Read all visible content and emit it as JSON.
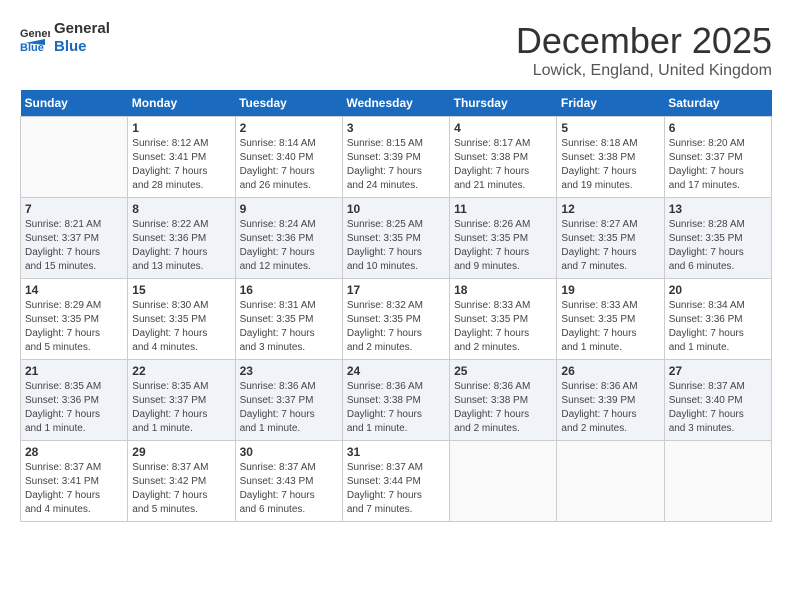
{
  "logo": {
    "general": "General",
    "blue": "Blue"
  },
  "title": "December 2025",
  "subtitle": "Lowick, England, United Kingdom",
  "days_header": [
    "Sunday",
    "Monday",
    "Tuesday",
    "Wednesday",
    "Thursday",
    "Friday",
    "Saturday"
  ],
  "weeks": [
    [
      {
        "day": "",
        "content": ""
      },
      {
        "day": "1",
        "content": "Sunrise: 8:12 AM\nSunset: 3:41 PM\nDaylight: 7 hours\nand 28 minutes."
      },
      {
        "day": "2",
        "content": "Sunrise: 8:14 AM\nSunset: 3:40 PM\nDaylight: 7 hours\nand 26 minutes."
      },
      {
        "day": "3",
        "content": "Sunrise: 8:15 AM\nSunset: 3:39 PM\nDaylight: 7 hours\nand 24 minutes."
      },
      {
        "day": "4",
        "content": "Sunrise: 8:17 AM\nSunset: 3:38 PM\nDaylight: 7 hours\nand 21 minutes."
      },
      {
        "day": "5",
        "content": "Sunrise: 8:18 AM\nSunset: 3:38 PM\nDaylight: 7 hours\nand 19 minutes."
      },
      {
        "day": "6",
        "content": "Sunrise: 8:20 AM\nSunset: 3:37 PM\nDaylight: 7 hours\nand 17 minutes."
      }
    ],
    [
      {
        "day": "7",
        "content": "Sunrise: 8:21 AM\nSunset: 3:37 PM\nDaylight: 7 hours\nand 15 minutes."
      },
      {
        "day": "8",
        "content": "Sunrise: 8:22 AM\nSunset: 3:36 PM\nDaylight: 7 hours\nand 13 minutes."
      },
      {
        "day": "9",
        "content": "Sunrise: 8:24 AM\nSunset: 3:36 PM\nDaylight: 7 hours\nand 12 minutes."
      },
      {
        "day": "10",
        "content": "Sunrise: 8:25 AM\nSunset: 3:35 PM\nDaylight: 7 hours\nand 10 minutes."
      },
      {
        "day": "11",
        "content": "Sunrise: 8:26 AM\nSunset: 3:35 PM\nDaylight: 7 hours\nand 9 minutes."
      },
      {
        "day": "12",
        "content": "Sunrise: 8:27 AM\nSunset: 3:35 PM\nDaylight: 7 hours\nand 7 minutes."
      },
      {
        "day": "13",
        "content": "Sunrise: 8:28 AM\nSunset: 3:35 PM\nDaylight: 7 hours\nand 6 minutes."
      }
    ],
    [
      {
        "day": "14",
        "content": "Sunrise: 8:29 AM\nSunset: 3:35 PM\nDaylight: 7 hours\nand 5 minutes."
      },
      {
        "day": "15",
        "content": "Sunrise: 8:30 AM\nSunset: 3:35 PM\nDaylight: 7 hours\nand 4 minutes."
      },
      {
        "day": "16",
        "content": "Sunrise: 8:31 AM\nSunset: 3:35 PM\nDaylight: 7 hours\nand 3 minutes."
      },
      {
        "day": "17",
        "content": "Sunrise: 8:32 AM\nSunset: 3:35 PM\nDaylight: 7 hours\nand 2 minutes."
      },
      {
        "day": "18",
        "content": "Sunrise: 8:33 AM\nSunset: 3:35 PM\nDaylight: 7 hours\nand 2 minutes."
      },
      {
        "day": "19",
        "content": "Sunrise: 8:33 AM\nSunset: 3:35 PM\nDaylight: 7 hours\nand 1 minute."
      },
      {
        "day": "20",
        "content": "Sunrise: 8:34 AM\nSunset: 3:36 PM\nDaylight: 7 hours\nand 1 minute."
      }
    ],
    [
      {
        "day": "21",
        "content": "Sunrise: 8:35 AM\nSunset: 3:36 PM\nDaylight: 7 hours\nand 1 minute."
      },
      {
        "day": "22",
        "content": "Sunrise: 8:35 AM\nSunset: 3:37 PM\nDaylight: 7 hours\nand 1 minute."
      },
      {
        "day": "23",
        "content": "Sunrise: 8:36 AM\nSunset: 3:37 PM\nDaylight: 7 hours\nand 1 minute."
      },
      {
        "day": "24",
        "content": "Sunrise: 8:36 AM\nSunset: 3:38 PM\nDaylight: 7 hours\nand 1 minute."
      },
      {
        "day": "25",
        "content": "Sunrise: 8:36 AM\nSunset: 3:38 PM\nDaylight: 7 hours\nand 2 minutes."
      },
      {
        "day": "26",
        "content": "Sunrise: 8:36 AM\nSunset: 3:39 PM\nDaylight: 7 hours\nand 2 minutes."
      },
      {
        "day": "27",
        "content": "Sunrise: 8:37 AM\nSunset: 3:40 PM\nDaylight: 7 hours\nand 3 minutes."
      }
    ],
    [
      {
        "day": "28",
        "content": "Sunrise: 8:37 AM\nSunset: 3:41 PM\nDaylight: 7 hours\nand 4 minutes."
      },
      {
        "day": "29",
        "content": "Sunrise: 8:37 AM\nSunset: 3:42 PM\nDaylight: 7 hours\nand 5 minutes."
      },
      {
        "day": "30",
        "content": "Sunrise: 8:37 AM\nSunset: 3:43 PM\nDaylight: 7 hours\nand 6 minutes."
      },
      {
        "day": "31",
        "content": "Sunrise: 8:37 AM\nSunset: 3:44 PM\nDaylight: 7 hours\nand 7 minutes."
      },
      {
        "day": "",
        "content": ""
      },
      {
        "day": "",
        "content": ""
      },
      {
        "day": "",
        "content": ""
      }
    ]
  ]
}
